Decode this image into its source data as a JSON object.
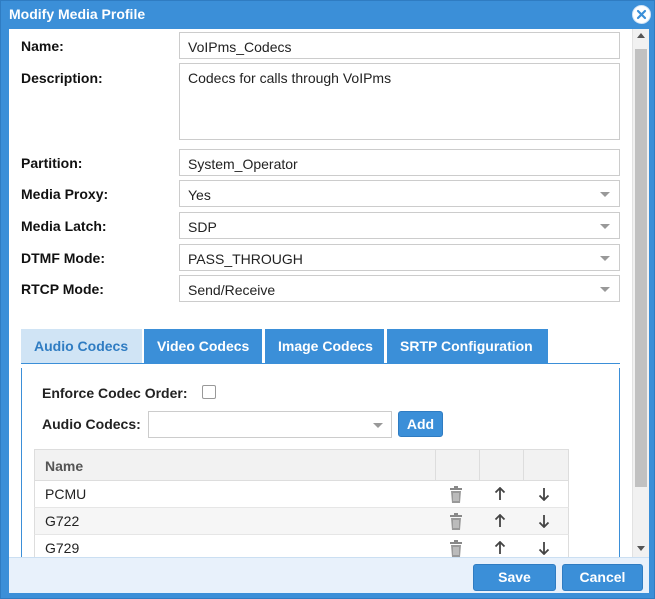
{
  "dialog": {
    "title": "Modify Media Profile"
  },
  "form": {
    "name": {
      "label": "Name:",
      "value": "VoIPms_Codecs"
    },
    "description": {
      "label": "Description:",
      "value": "Codecs for calls through VoIPms"
    },
    "partition": {
      "label": "Partition:",
      "value": "System_Operator"
    },
    "media_proxy": {
      "label": "Media Proxy:",
      "value": "Yes"
    },
    "media_latch": {
      "label": "Media Latch:",
      "value": "SDP"
    },
    "dtmf_mode": {
      "label": "DTMF Mode:",
      "value": "PASS_THROUGH"
    },
    "rtcp_mode": {
      "label": "RTCP Mode:",
      "value": "Send/Receive"
    }
  },
  "tabs": [
    {
      "label": "Audio Codecs",
      "active": true
    },
    {
      "label": "Video Codecs",
      "active": false
    },
    {
      "label": "Image Codecs",
      "active": false
    },
    {
      "label": "SRTP Configuration",
      "active": false
    }
  ],
  "audio": {
    "enforce_label": "Enforce Codec Order:",
    "enforce_checked": false,
    "codecs_label": "Audio Codecs:",
    "codecs_value": "",
    "add_label": "Add",
    "grid": {
      "header": "Name",
      "rows": [
        {
          "name": "PCMU"
        },
        {
          "name": "G722"
        },
        {
          "name": "G729"
        }
      ]
    }
  },
  "footer": {
    "save_label": "Save",
    "cancel_label": "Cancel"
  },
  "colors": {
    "accent": "#3b8fd8",
    "active_tab_bg": "#d0e4f5"
  },
  "icons": {
    "close": "close-icon",
    "delete": "trash-icon",
    "move_up": "arrow-up-icon",
    "move_down": "arrow-down-icon",
    "dropdown": "chevron-down-icon"
  }
}
